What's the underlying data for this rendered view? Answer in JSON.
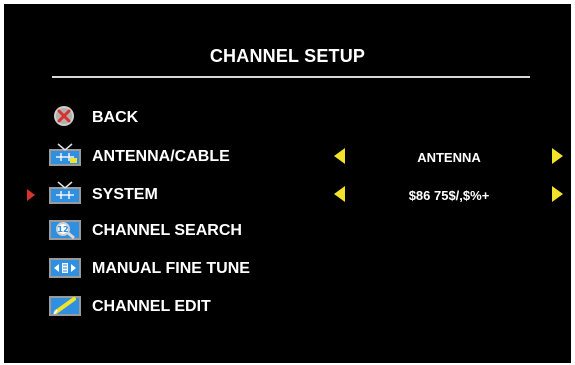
{
  "title": "CHANNEL SETUP",
  "menu": {
    "selected_index": 2,
    "items": [
      {
        "label": "BACK",
        "icon": "back-x-icon"
      },
      {
        "label": "ANTENNA/CABLE",
        "icon": "antenna-cable-icon",
        "value": "ANTENNA"
      },
      {
        "label": "SYSTEM",
        "icon": "system-icon",
        "value": "$86 75$/,$%+"
      },
      {
        "label": "CHANNEL SEARCH",
        "icon": "channel-search-icon"
      },
      {
        "label": "MANUAL FINE TUNE",
        "icon": "manual-fine-tune-icon"
      },
      {
        "label": "CHANNEL EDIT",
        "icon": "channel-edit-icon"
      }
    ]
  },
  "colors": {
    "background": "#000000",
    "text": "#ffffff",
    "arrow": "#f2e22a",
    "selector": "#d8322c",
    "icon_blue": "#2f8fe0"
  }
}
